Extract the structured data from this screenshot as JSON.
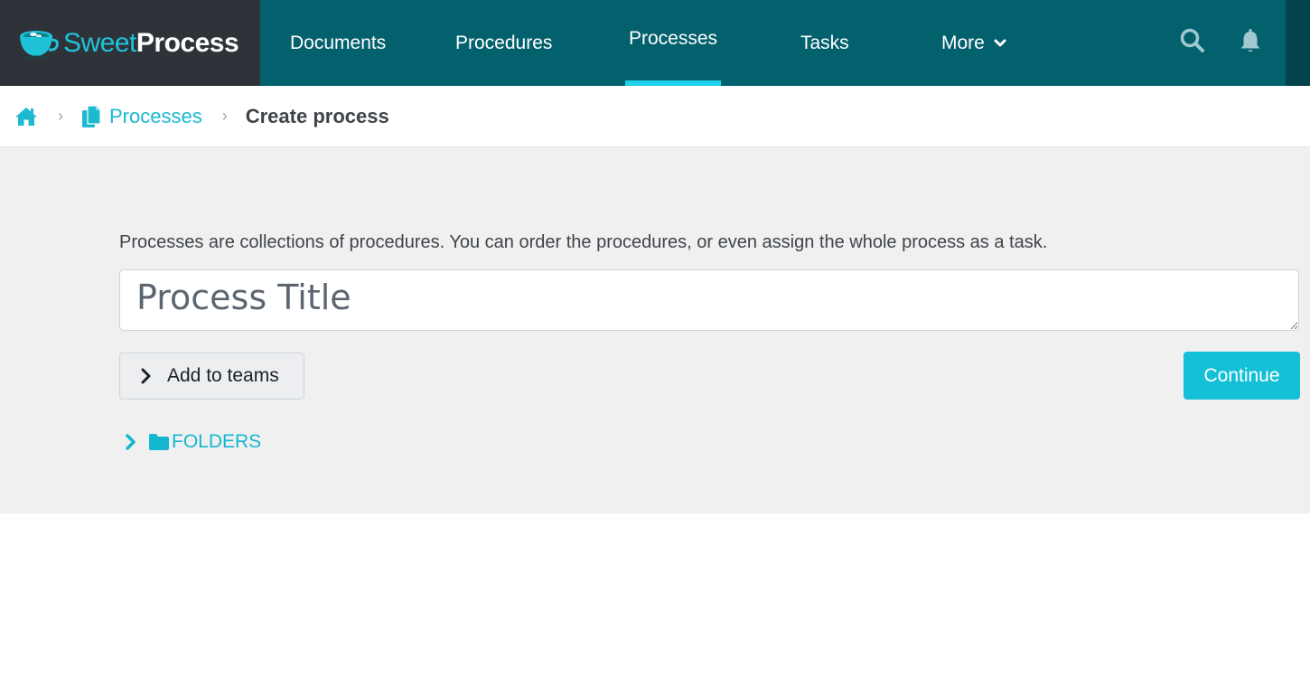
{
  "brand": {
    "name_part1": "Sweet",
    "name_part2": "Process"
  },
  "nav": {
    "items": [
      {
        "label": "Documents",
        "active": false
      },
      {
        "label": "Procedures",
        "active": false
      },
      {
        "label": "Processes",
        "active": true
      },
      {
        "label": "Tasks",
        "active": false
      },
      {
        "label": "More",
        "active": false,
        "dropdown": true
      }
    ],
    "icons": [
      "search-icon",
      "bell-icon"
    ]
  },
  "breadcrumb": {
    "home_icon": "home-icon",
    "separator": "›",
    "link_label": "Processes",
    "link_icon": "documents-icon",
    "current": "Create process"
  },
  "main": {
    "helper_text": "Processes are collections of procedures. You can order the procedures, or even assign the whole process as a task.",
    "title_input": {
      "placeholder": "Process Title",
      "value": ""
    },
    "add_to_teams_label": "Add to teams",
    "continue_label": "Continue",
    "folders_label": "FOLDERS"
  },
  "colors": {
    "nav_bg": "#03606d",
    "brand_bg": "#2e333a",
    "accent": "#13c0d6",
    "active_underline": "#1fd0ea",
    "main_bg": "#f0f0f0"
  }
}
